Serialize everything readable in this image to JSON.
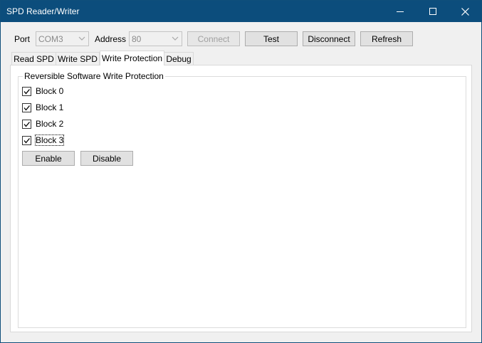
{
  "window": {
    "title": "SPD Reader/Writer"
  },
  "titlebar": {
    "minimize_icon": "minimize-icon",
    "maximize_icon": "maximize-icon",
    "close_icon": "close-icon"
  },
  "toolbar": {
    "port_label": "Port",
    "port_value": "COM3",
    "address_label": "Address",
    "address_value": "80",
    "connect_label": "Connect",
    "test_label": "Test",
    "disconnect_label": "Disconnect",
    "refresh_label": "Refresh"
  },
  "tabs": [
    {
      "label": "Read SPD",
      "active": false
    },
    {
      "label": "Write SPD",
      "active": false
    },
    {
      "label": "Write Protection",
      "active": true
    },
    {
      "label": "Debug",
      "active": false
    }
  ],
  "write_protection": {
    "group_title": "Reversible Software Write Protection",
    "blocks": [
      {
        "label": "Block 0",
        "checked": true
      },
      {
        "label": "Block 1",
        "checked": true
      },
      {
        "label": "Block 2",
        "checked": true
      },
      {
        "label": "Block 3",
        "checked": true
      }
    ],
    "enable_label": "Enable",
    "disable_label": "Disable"
  }
}
